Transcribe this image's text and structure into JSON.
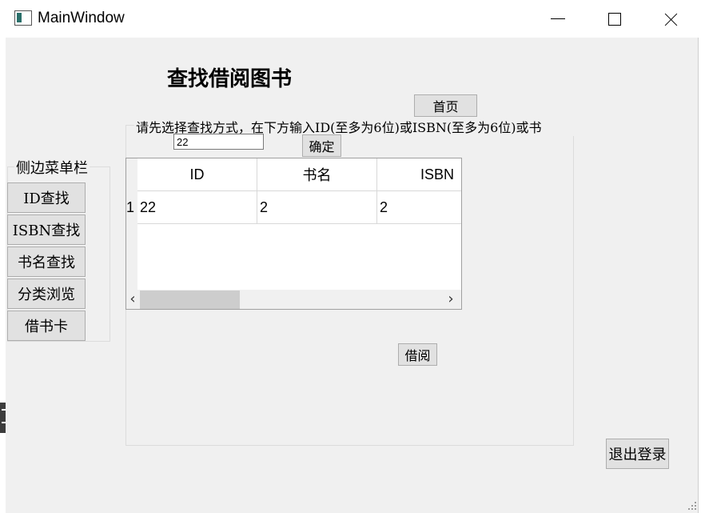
{
  "window": {
    "title": "MainWindow"
  },
  "page": {
    "title": "查找借阅图书",
    "home_button": "首页",
    "instruction": "请先选择查找方式，在下方输入ID(至多为6位)或ISBN(至多为6位)或书",
    "search_value": "22",
    "confirm_button": "确定",
    "borrow_button": "借阅",
    "logout_button": "退出登录"
  },
  "table": {
    "headers": [
      "ID",
      "书名",
      "ISBN"
    ],
    "rows": [
      {
        "row_number": "1",
        "cells": [
          "22",
          "2",
          "2"
        ]
      }
    ]
  },
  "sidebar": {
    "title": "侧边菜单栏",
    "items": [
      {
        "label": "ID查找"
      },
      {
        "label": "ISBN查找"
      },
      {
        "label": "书名查找"
      },
      {
        "label": "分类浏览"
      },
      {
        "label": "借书卡"
      }
    ]
  },
  "icons": {
    "app": "app-window-icon",
    "minimize": "minimize-icon",
    "maximize": "maximize-icon",
    "close": "close-icon",
    "scroll_left": "chevron-left-icon",
    "scroll_right": "chevron-right-icon",
    "resize": "resize-grip-icon"
  }
}
